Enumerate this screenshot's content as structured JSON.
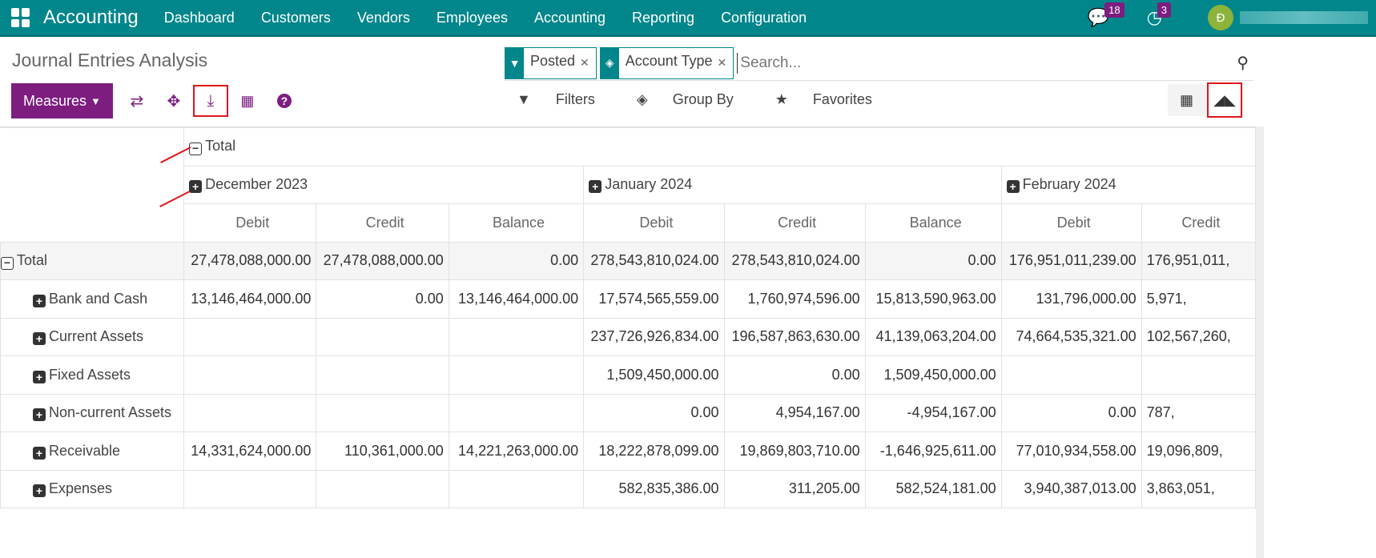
{
  "nav": {
    "brand": "Accounting",
    "menu": [
      "Dashboard",
      "Customers",
      "Vendors",
      "Employees",
      "Accounting",
      "Reporting",
      "Configuration"
    ],
    "messages_count": "18",
    "activities_count": "3",
    "avatar_initial": "Đ"
  },
  "page": {
    "title": "Journal Entries Analysis"
  },
  "toolbar": {
    "measures": "Measures"
  },
  "search": {
    "facets": [
      {
        "icon": "filter-icon",
        "label": "Posted"
      },
      {
        "icon": "layers-icon",
        "label": "Account Type"
      }
    ],
    "placeholder": "Search..."
  },
  "filters": {
    "filters": "Filters",
    "group_by": "Group By",
    "favorites": "Favorites"
  },
  "pivot": {
    "col_total": "Total",
    "months": [
      "December 2023",
      "January 2024",
      "February 2024"
    ],
    "measures": [
      "Debit",
      "Credit",
      "Balance",
      "Debit",
      "Credit",
      "Balance",
      "Debit",
      "Credit"
    ],
    "rows": [
      {
        "label": "Total",
        "cells": [
          "27,478,088,000.00",
          "27,478,088,000.00",
          "0.00",
          "278,543,810,024.00",
          "278,543,810,024.00",
          "0.00",
          "176,951,011,239.00",
          "176,951,011,"
        ]
      },
      {
        "label": "Bank and Cash",
        "cells": [
          "13,146,464,000.00",
          "0.00",
          "13,146,464,000.00",
          "17,574,565,559.00",
          "1,760,974,596.00",
          "15,813,590,963.00",
          "131,796,000.00",
          "5,971,"
        ]
      },
      {
        "label": "Current Assets",
        "cells": [
          "",
          "",
          "",
          "237,726,926,834.00",
          "196,587,863,630.00",
          "41,139,063,204.00",
          "74,664,535,321.00",
          "102,567,260,"
        ]
      },
      {
        "label": "Fixed Assets",
        "cells": [
          "",
          "",
          "",
          "1,509,450,000.00",
          "0.00",
          "1,509,450,000.00",
          "",
          ""
        ]
      },
      {
        "label": "Non-current Assets",
        "cells": [
          "",
          "",
          "",
          "0.00",
          "4,954,167.00",
          "-4,954,167.00",
          "0.00",
          "787,"
        ]
      },
      {
        "label": "Receivable",
        "cells": [
          "14,331,624,000.00",
          "110,361,000.00",
          "14,221,263,000.00",
          "18,222,878,099.00",
          "19,869,803,710.00",
          "-1,646,925,611.00",
          "77,010,934,558.00",
          "19,096,809,"
        ]
      },
      {
        "label": "Expenses",
        "cells": [
          "",
          "",
          "",
          "582,835,386.00",
          "311,205.00",
          "582,524,181.00",
          "3,940,387,013.00",
          "3,863,051,"
        ]
      }
    ]
  },
  "colors": {
    "nav": "#00868b",
    "accent": "#7c1d7f",
    "highlight": "#e0151c"
  }
}
